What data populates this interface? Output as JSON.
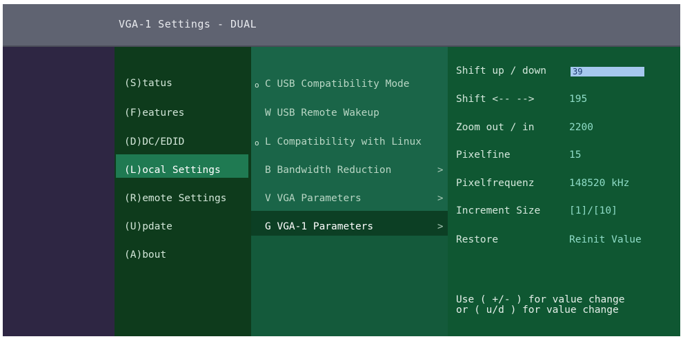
{
  "window": {
    "title": "VGA-1 Settings - DUAL"
  },
  "menu": {
    "items": [
      {
        "label": "(S)tatus"
      },
      {
        "label": "(F)eatures"
      },
      {
        "label": "(D)DC/EDID"
      },
      {
        "label": "(L)ocal  Settings",
        "selected": true
      },
      {
        "label": "(R)emote Settings"
      },
      {
        "label": "(U)pdate"
      },
      {
        "label": "(A)bout"
      }
    ]
  },
  "submenu": {
    "items": [
      {
        "label": "C USB Compatibility Mode",
        "bullet": "o",
        "arrow": ""
      },
      {
        "label": "W USB Remote Wakeup",
        "bullet": "",
        "arrow": ""
      },
      {
        "label": "L Compatibility with Linux",
        "bullet": "o",
        "arrow": ""
      },
      {
        "label": "B Bandwidth Reduction",
        "bullet": "",
        "arrow": ">"
      },
      {
        "label": "V VGA   Parameters",
        "bullet": "",
        "arrow": ">"
      },
      {
        "label": "G VGA-1 Parameters",
        "bullet": "",
        "arrow": ">",
        "selected": true
      }
    ]
  },
  "params": {
    "shift_ud": {
      "label": "Shift up / down",
      "value": "39"
    },
    "shift_lr": {
      "label": "Shift <-- -->",
      "value": "195"
    },
    "zoom": {
      "label": "Zoom out / in",
      "value": "2200"
    },
    "pixelfine": {
      "label": "Pixelfine",
      "value": "15"
    },
    "pixelfreq": {
      "label": "Pixelfrequenz",
      "value": "148520 kHz"
    },
    "increment": {
      "label": "Increment Size",
      "value": "[1]/[10]"
    },
    "restore": {
      "label": "Restore",
      "value": "Reinit Value"
    },
    "hint1": "Use ( +/- ) for value change",
    "hint2": "or  ( u/d ) for value change"
  },
  "colors": {
    "titlebar": "#5f6371",
    "menu_bg": "#0e3b1c",
    "menu_selected": "#1f7a52",
    "submenu_bg": "#1a6548",
    "submenu_selected": "#0c3f24",
    "params_bg": "#0f5732",
    "value_text": "#8fdcc7",
    "input_highlight": "#a6c8ee"
  }
}
